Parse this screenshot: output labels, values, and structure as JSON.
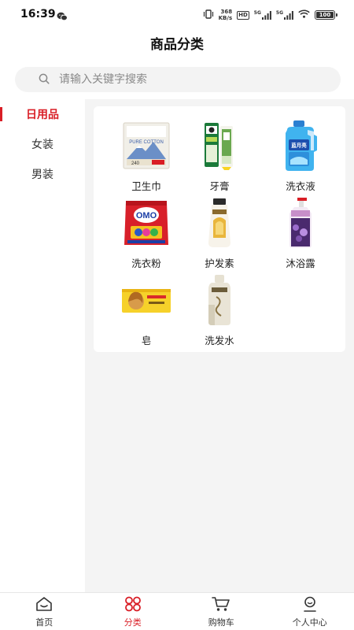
{
  "status": {
    "time": "16:39",
    "net_speed_value": "368",
    "net_speed_unit": "KB/s",
    "hd": "HD",
    "sim1": "5G",
    "sim2": "5G",
    "battery": "100"
  },
  "header": {
    "title": "商品分类"
  },
  "search": {
    "placeholder": "请输入关键字搜索"
  },
  "sidebar": {
    "items": [
      {
        "label": "日用品",
        "active": true
      },
      {
        "label": "女装",
        "active": false
      },
      {
        "label": "男装",
        "active": false
      }
    ]
  },
  "products": [
    {
      "name": "卫生巾",
      "icon": "sanitary-pad-package"
    },
    {
      "name": "牙膏",
      "icon": "toothpaste-box"
    },
    {
      "name": "洗衣液",
      "icon": "laundry-detergent-bottle"
    },
    {
      "name": "洗衣粉",
      "icon": "washing-powder-bag"
    },
    {
      "name": "护发素",
      "icon": "conditioner-tube"
    },
    {
      "name": "沐浴露",
      "icon": "body-wash-bottle"
    },
    {
      "name": "皂",
      "icon": "soap-bar"
    },
    {
      "name": "洗发水",
      "icon": "shampoo-bottle"
    }
  ],
  "product_image_text": {
    "pad_brand": "PURE COTTON",
    "pad_count": "240",
    "detergent_brand": "蓝月亮",
    "powder_brand": "OMO"
  },
  "tabbar": {
    "items": [
      {
        "label": "首页",
        "icon": "home-icon",
        "active": false
      },
      {
        "label": "分类",
        "icon": "category-icon",
        "active": true
      },
      {
        "label": "购物车",
        "icon": "cart-icon",
        "active": false
      },
      {
        "label": "个人中心",
        "icon": "profile-icon",
        "active": false
      }
    ]
  },
  "colors": {
    "accent": "#d91e26",
    "content_bg": "#f4f4f4",
    "search_bg": "#f3f3f3"
  }
}
